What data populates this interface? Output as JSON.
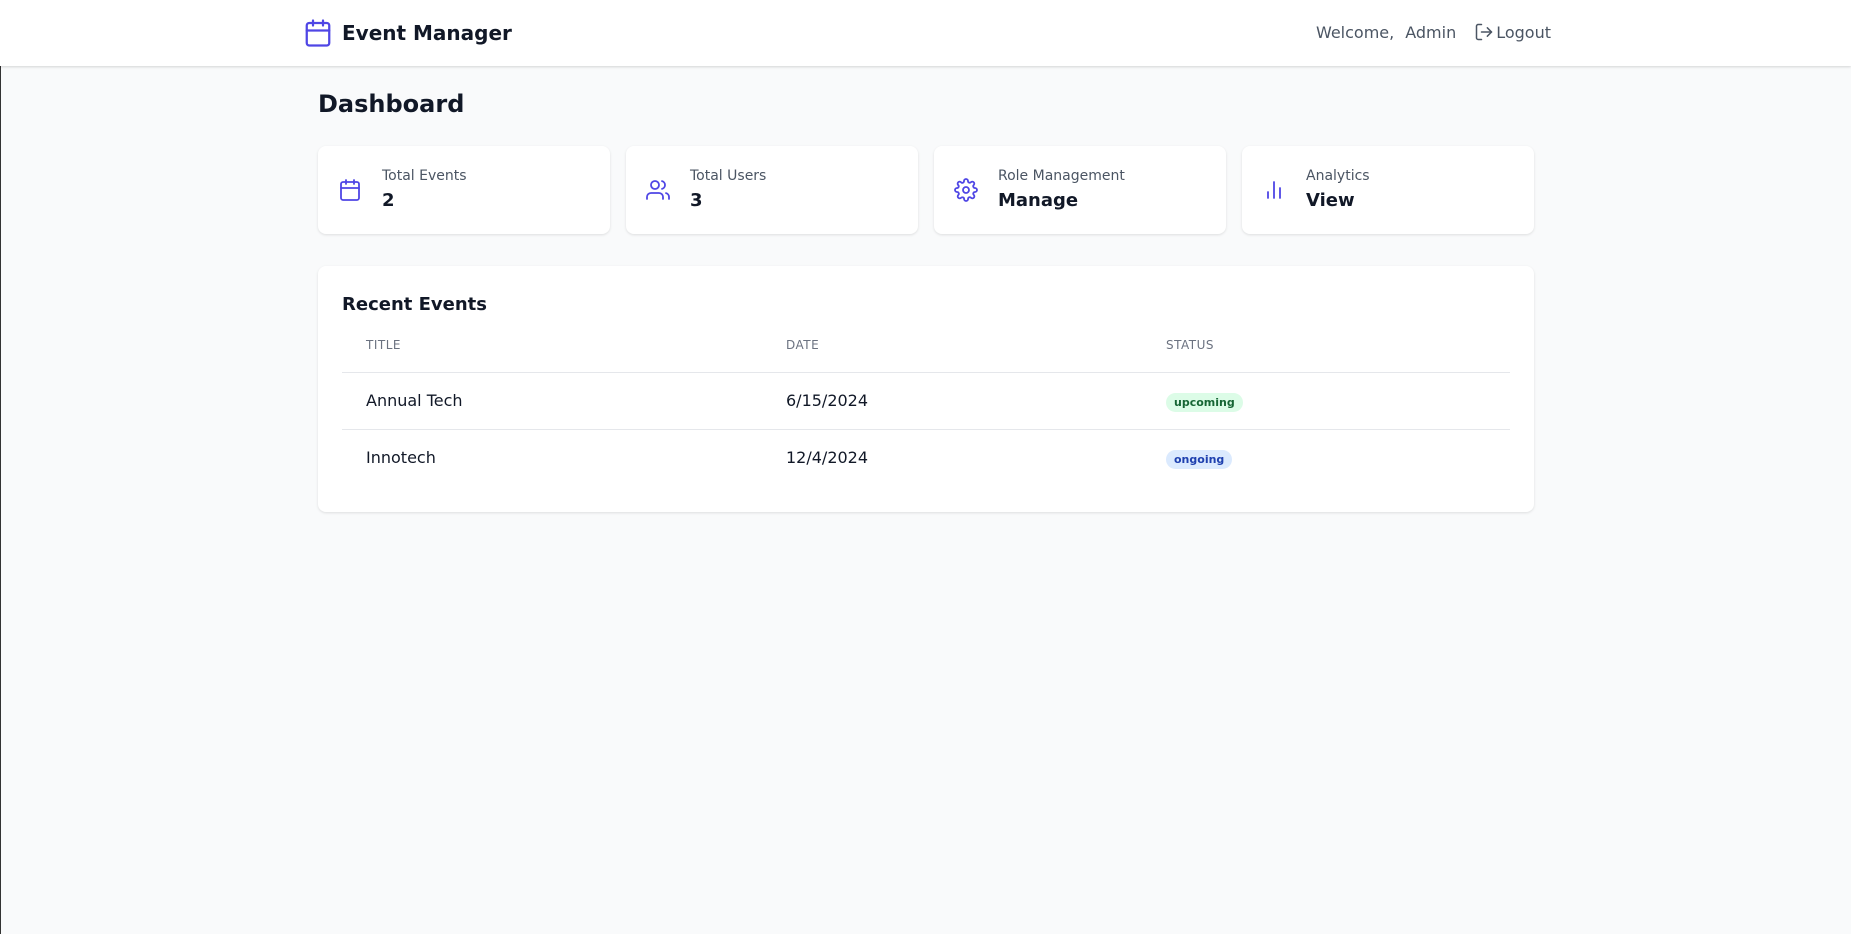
{
  "header": {
    "brand_title": "Event Manager",
    "welcome_text": "Welcome,",
    "username": "Admin",
    "logout_label": "Logout"
  },
  "page": {
    "title": "Dashboard"
  },
  "stats": [
    {
      "label": "Total Events",
      "value": "2",
      "icon": "calendar-icon"
    },
    {
      "label": "Total Users",
      "value": "3",
      "icon": "users-icon"
    },
    {
      "label": "Role Management",
      "value": "Manage",
      "icon": "gear-icon"
    },
    {
      "label": "Analytics",
      "value": "View",
      "icon": "bar-chart-icon"
    }
  ],
  "recent_events": {
    "title": "Recent Events",
    "columns": [
      "TITLE",
      "DATE",
      "STATUS"
    ],
    "rows": [
      {
        "title": "Annual Tech",
        "date": "6/15/2024",
        "status": "upcoming"
      },
      {
        "title": "Innotech",
        "date": "12/4/2024",
        "status": "ongoing"
      }
    ]
  },
  "colors": {
    "accent": "#4f46e5",
    "upcoming_bg": "#dcfce7",
    "upcoming_text": "#166534",
    "ongoing_bg": "#dbeafe",
    "ongoing_text": "#1e40af"
  }
}
